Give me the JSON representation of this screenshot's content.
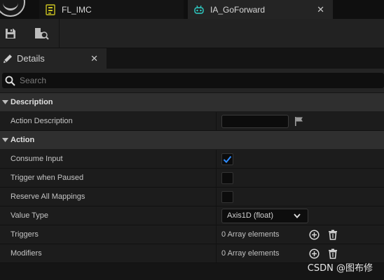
{
  "tabs": [
    {
      "label": "FL_IMC",
      "icon": "input-mapping-context-icon"
    },
    {
      "label": "IA_GoForward",
      "icon": "input-action-icon",
      "active": true
    }
  ],
  "toolbar": {
    "buttons": [
      "save-icon",
      "browse-to-asset-icon"
    ]
  },
  "details_panel": {
    "tab_label": "Details",
    "search_placeholder": "Search",
    "categories": [
      {
        "label": "Description",
        "properties": [
          {
            "name": "Action Description",
            "value": "",
            "type": "text"
          }
        ]
      },
      {
        "label": "Action",
        "properties": [
          {
            "name": "Consume Input",
            "checked": true,
            "type": "checkbox"
          },
          {
            "name": "Trigger when Paused",
            "checked": false,
            "type": "checkbox"
          },
          {
            "name": "Reserve All Mappings",
            "checked": false,
            "type": "checkbox"
          },
          {
            "name": "Value Type",
            "value": "Axis1D (float)",
            "type": "dropdown"
          },
          {
            "name": "Triggers",
            "value": "0 Array elements",
            "type": "array"
          },
          {
            "name": "Modifiers",
            "value": "0 Array elements",
            "type": "array"
          }
        ]
      }
    ]
  },
  "watermark": "CSDN @图布修",
  "colors": {
    "accent_blue": "#2f8cff",
    "tab_ia_icon": "#2fd0c8",
    "tab_imc_icon": "#c8c020"
  }
}
